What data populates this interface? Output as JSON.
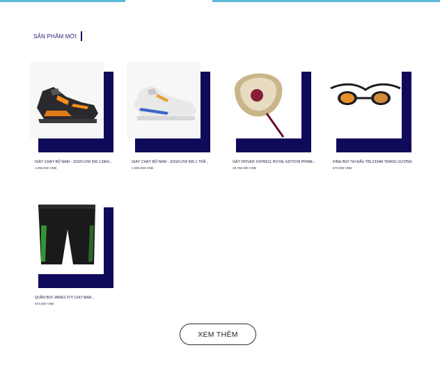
{
  "section": {
    "title": "SẢN PHẨM MỚI"
  },
  "products": [
    {
      "name": "GIÀY CHẠY BỘ NAM - JOGFLOW 500.1 ĐEN...",
      "price": "1.090.000 VNĐ",
      "icon": "running-shoe-black-icon"
    },
    {
      "name": "GIÀY CHẠY BỘ NAM - JOGFLOW 500.1 TRẮ...",
      "price": "1.090.000 VNĐ",
      "icon": "running-shoe-white-icon"
    },
    {
      "name": "GẬY DRIVER XXPRE11 ROYAL EDITION PRIME...",
      "price": "29.750.000 VNĐ",
      "icon": "golf-driver-icon"
    },
    {
      "name": "KÍNH BƠI THI ĐẤU YBL2334M TRÁNG GƯƠNG",
      "price": "670.000 VNĐ",
      "icon": "swim-goggles-icon"
    },
    {
      "name": "QUẦN BƠI JAMES FITI CHO NAM...",
      "price": "573.000 VNĐ",
      "icon": "swim-shorts-icon"
    }
  ],
  "actions": {
    "more_label": "XEM THÊM"
  },
  "colors": {
    "accent_navy": "#100a5a",
    "top_bar": "#5bb8d6"
  }
}
